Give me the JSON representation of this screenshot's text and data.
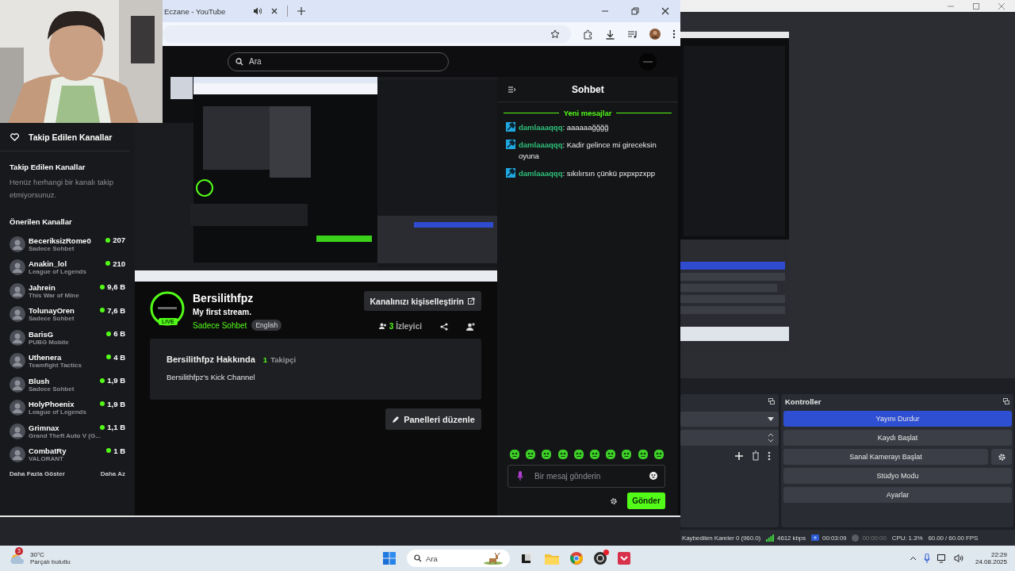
{
  "browser": {
    "tab_title": "Eczane - YouTube"
  },
  "site": {
    "search": {
      "placeholder": "Ara"
    },
    "sidebar": {
      "title": "Takip Edilen Kanallar",
      "followed_heading": "Takip Edilen Kanallar",
      "followed_empty": "Henüz herhangi bir kanalı takip etmiyorsunuz.",
      "recommended_heading": "Önerilen Kanallar",
      "channels": [
        {
          "name": "BeceriksizRome0",
          "category": "Sadece Sohbet",
          "viewers": "207"
        },
        {
          "name": "Anakin_lol",
          "category": "League of Legends",
          "viewers": "210"
        },
        {
          "name": "Jahrein",
          "category": "This War of Mine",
          "viewers": "9,6 B"
        },
        {
          "name": "TolunayOren",
          "category": "Sadece Sohbet",
          "viewers": "7,6 B"
        },
        {
          "name": "BarisG",
          "category": "PUBG Mobile",
          "viewers": "6 B"
        },
        {
          "name": "Uthenera",
          "category": "Teamfight Tactics",
          "viewers": "4 B"
        },
        {
          "name": "Blush",
          "category": "Sadece Sohbet",
          "viewers": "1,9 B"
        },
        {
          "name": "HolyPhoenix",
          "category": "League of Legends",
          "viewers": "1,9 B"
        },
        {
          "name": "Grimnax",
          "category": "Grand Theft Auto V (G...",
          "viewers": "1,1 B"
        },
        {
          "name": "CombatRy",
          "category": "VALORANT",
          "viewers": "1 B"
        }
      ],
      "show_more": "Daha Fazla Göster",
      "show_less": "Daha Az"
    },
    "channel": {
      "name": "Bersilithfpz",
      "stream_title": "My first stream.",
      "category": "Sadece Sohbet",
      "tag": "English",
      "live_badge": "LIVE",
      "customize_button": "Kanalınızı kişiselleştirin",
      "viewer_count": "3",
      "viewer_label": "İzleyici",
      "about_title": "Bersilithfpz Hakkında",
      "follower_count": "1",
      "follower_label": "Takipçi",
      "about_text": "Bersilithfpz's Kick Channel",
      "edit_panels_button": "Panelleri düzenle"
    },
    "chat": {
      "title": "Sohbet",
      "new_messages": "Yeni mesajlar",
      "messages": [
        {
          "user": "damlaaaqqq",
          "text": ": aaaaaağğğğ"
        },
        {
          "user": "damlaaaqqq",
          "text": ": Kadir gelince mi gireceksin oyuna"
        },
        {
          "user": "damlaaaqqq",
          "text": ": sıkılırsın çünkü pxpxpzxpp"
        }
      ],
      "input": {
        "placeholder": "Bir mesaj gönderin"
      },
      "send_button": "Gönder"
    }
  },
  "obs": {
    "controls_title": "Kontroller",
    "controls": [
      {
        "label": "Yayını Durdur",
        "active": true,
        "kind": "button"
      },
      {
        "label": "Kaydı Başlat",
        "active": false,
        "kind": "button"
      },
      {
        "label": "Sanal Kamerayı Başlat",
        "active": false,
        "kind": "button_with_settings"
      },
      {
        "label": "Stüdyo Modu",
        "active": false,
        "kind": "button"
      },
      {
        "label": "Ayarlar",
        "active": false,
        "kind": "button"
      }
    ],
    "status": {
      "dropped_frames": "Kaybedilen Kareler 0 (960.0)",
      "bitrate": "4612 kbps",
      "stream_time": "00:03:09",
      "record_time": "00:00:00",
      "cpu": "CPU: 1.3%",
      "fps": "60.00 / 60.00 FPS"
    }
  },
  "taskbar": {
    "weather": {
      "temperature": "30°C",
      "condition": "Parçalı bulutlu",
      "badge": "3"
    },
    "search": {
      "placeholder": "Ara"
    },
    "clock": {
      "time": "22:29",
      "date": "24.08.2025"
    }
  }
}
